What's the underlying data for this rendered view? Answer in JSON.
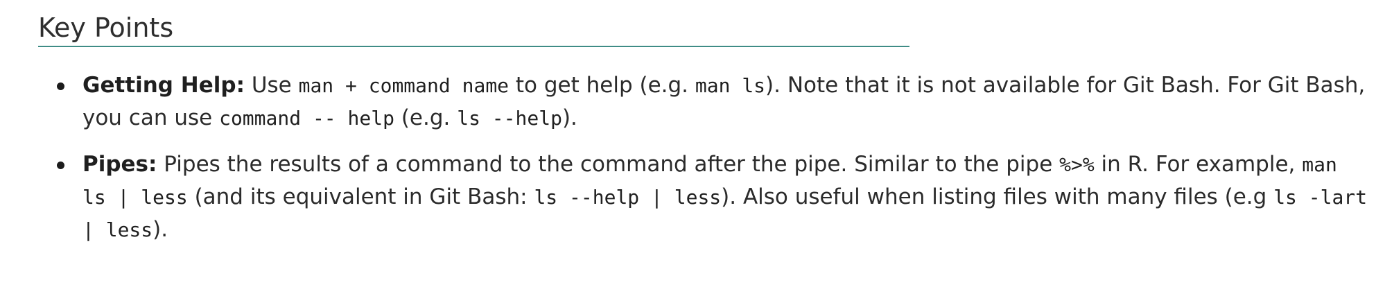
{
  "heading": "Key Points",
  "points": [
    {
      "term": "Getting Help:",
      "segments": [
        {
          "type": "text",
          "value": " Use "
        },
        {
          "type": "code",
          "value": "man + command name"
        },
        {
          "type": "text",
          "value": " to get help (e.g. "
        },
        {
          "type": "code",
          "value": "man ls"
        },
        {
          "type": "text",
          "value": "). Note that it is not available for Git Bash. For Git Bash, you can use "
        },
        {
          "type": "code",
          "value": "command -- help"
        },
        {
          "type": "text",
          "value": " (e.g. "
        },
        {
          "type": "code",
          "value": "ls --help"
        },
        {
          "type": "text",
          "value": ")."
        }
      ]
    },
    {
      "term": "Pipes:",
      "segments": [
        {
          "type": "text",
          "value": " Pipes the results of a command to the command after the pipe. Similar to the pipe "
        },
        {
          "type": "code",
          "value": "%>%"
        },
        {
          "type": "text",
          "value": " in R. For example, "
        },
        {
          "type": "code",
          "value": "man ls | less"
        },
        {
          "type": "text",
          "value": " (and its equivalent in Git Bash: "
        },
        {
          "type": "code",
          "value": "ls --help | less"
        },
        {
          "type": "text",
          "value": "). Also useful when listing files with many files (e.g "
        },
        {
          "type": "code",
          "value": "ls -lart | less"
        },
        {
          "type": "text",
          "value": ")."
        }
      ]
    }
  ]
}
